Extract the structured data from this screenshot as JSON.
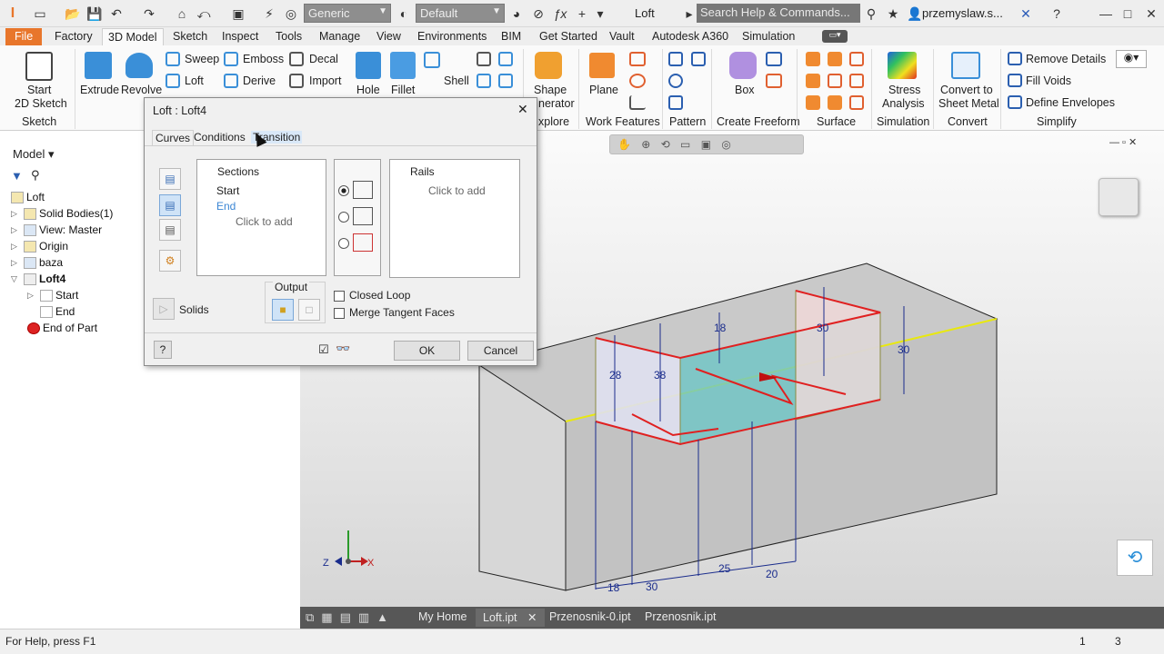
{
  "app": {
    "title": "Loft",
    "user": "przemyslaw.s...",
    "search_placeholder": "Search Help & Commands...",
    "material": "Generic",
    "appearance": "Default"
  },
  "menu": {
    "file": "File",
    "tabs": [
      "Factory",
      "3D Model",
      "Sketch",
      "Inspect",
      "Tools",
      "Manage",
      "View",
      "Environments",
      "BIM",
      "Get Started",
      "Vault",
      "Autodesk A360",
      "Simulation"
    ]
  },
  "ribbon": {
    "sketch": {
      "start1": "Start",
      "start2": "2D Sketch",
      "group": "Sketch"
    },
    "create": {
      "extrude": "Extrude",
      "revolve": "Revolve",
      "sweep": "Sweep",
      "loft": "Loft",
      "emboss": "Emboss",
      "derive": "Derive",
      "decal": "Decal",
      "import": "Import"
    },
    "modify": {
      "hole": "Hole",
      "fillet": "Fillet",
      "shell": "Shell"
    },
    "explore": {
      "shape1": "Shape",
      "shape2": "nerator",
      "group": "xplore"
    },
    "work": {
      "plane": "Plane",
      "group": "Work Features"
    },
    "pattern": {
      "group": "Pattern"
    },
    "freeform": {
      "box": "Box",
      "group": "Create Freeform"
    },
    "surface": {
      "group": "Surface"
    },
    "simulation": {
      "stress1": "Stress",
      "stress2": "Analysis",
      "group": "Simulation"
    },
    "convert": {
      "c1": "Convert to",
      "c2": "Sheet Metal",
      "group": "Convert"
    },
    "simplify": {
      "remove": "Remove Details",
      "fill": "Fill Voids",
      "define": "Define Envelopes",
      "group": "Simplify"
    }
  },
  "browser": {
    "header": "Model",
    "items": [
      {
        "label": "Loft",
        "bold": false
      },
      {
        "label": "Solid Bodies(1)",
        "bold": false
      },
      {
        "label": "View: Master",
        "bold": false
      },
      {
        "label": "Origin",
        "bold": false
      },
      {
        "label": "baza",
        "bold": false
      },
      {
        "label": "Loft4",
        "bold": true
      },
      {
        "label": "Start",
        "bold": false
      },
      {
        "label": "End",
        "bold": false
      },
      {
        "label": "End of Part",
        "bold": false
      }
    ]
  },
  "dialog": {
    "title": "Loft : Loft4",
    "tabs": [
      "Curves",
      "Conditions",
      "Transition"
    ],
    "sections": {
      "header": "Sections",
      "items": [
        "Start",
        "End"
      ],
      "add": "Click to add"
    },
    "rails": {
      "header": "Rails",
      "add": "Click to add"
    },
    "solids": "Solids",
    "output": "Output",
    "closed_loop": "Closed Loop",
    "merge": "Merge Tangent Faces",
    "ok": "OK",
    "cancel": "Cancel",
    "help": "?"
  },
  "dimensions": [
    "18",
    "28",
    "38",
    "30",
    "30",
    "18",
    "30",
    "25",
    "20"
  ],
  "doctabs": {
    "home": "My Home",
    "tabs": [
      "Loft.ipt",
      "Przenosnik-0.ipt",
      "Przenosnik.ipt"
    ]
  },
  "status": {
    "help": "For Help, press F1",
    "n1": "1",
    "n2": "3"
  },
  "axes": {
    "x": "X",
    "z": "Z"
  },
  "colors": {
    "accent": "#e8762b",
    "loft_red": "#e02020",
    "dim_blue": "#1a2c8c",
    "selection": "#6ec6c6"
  }
}
